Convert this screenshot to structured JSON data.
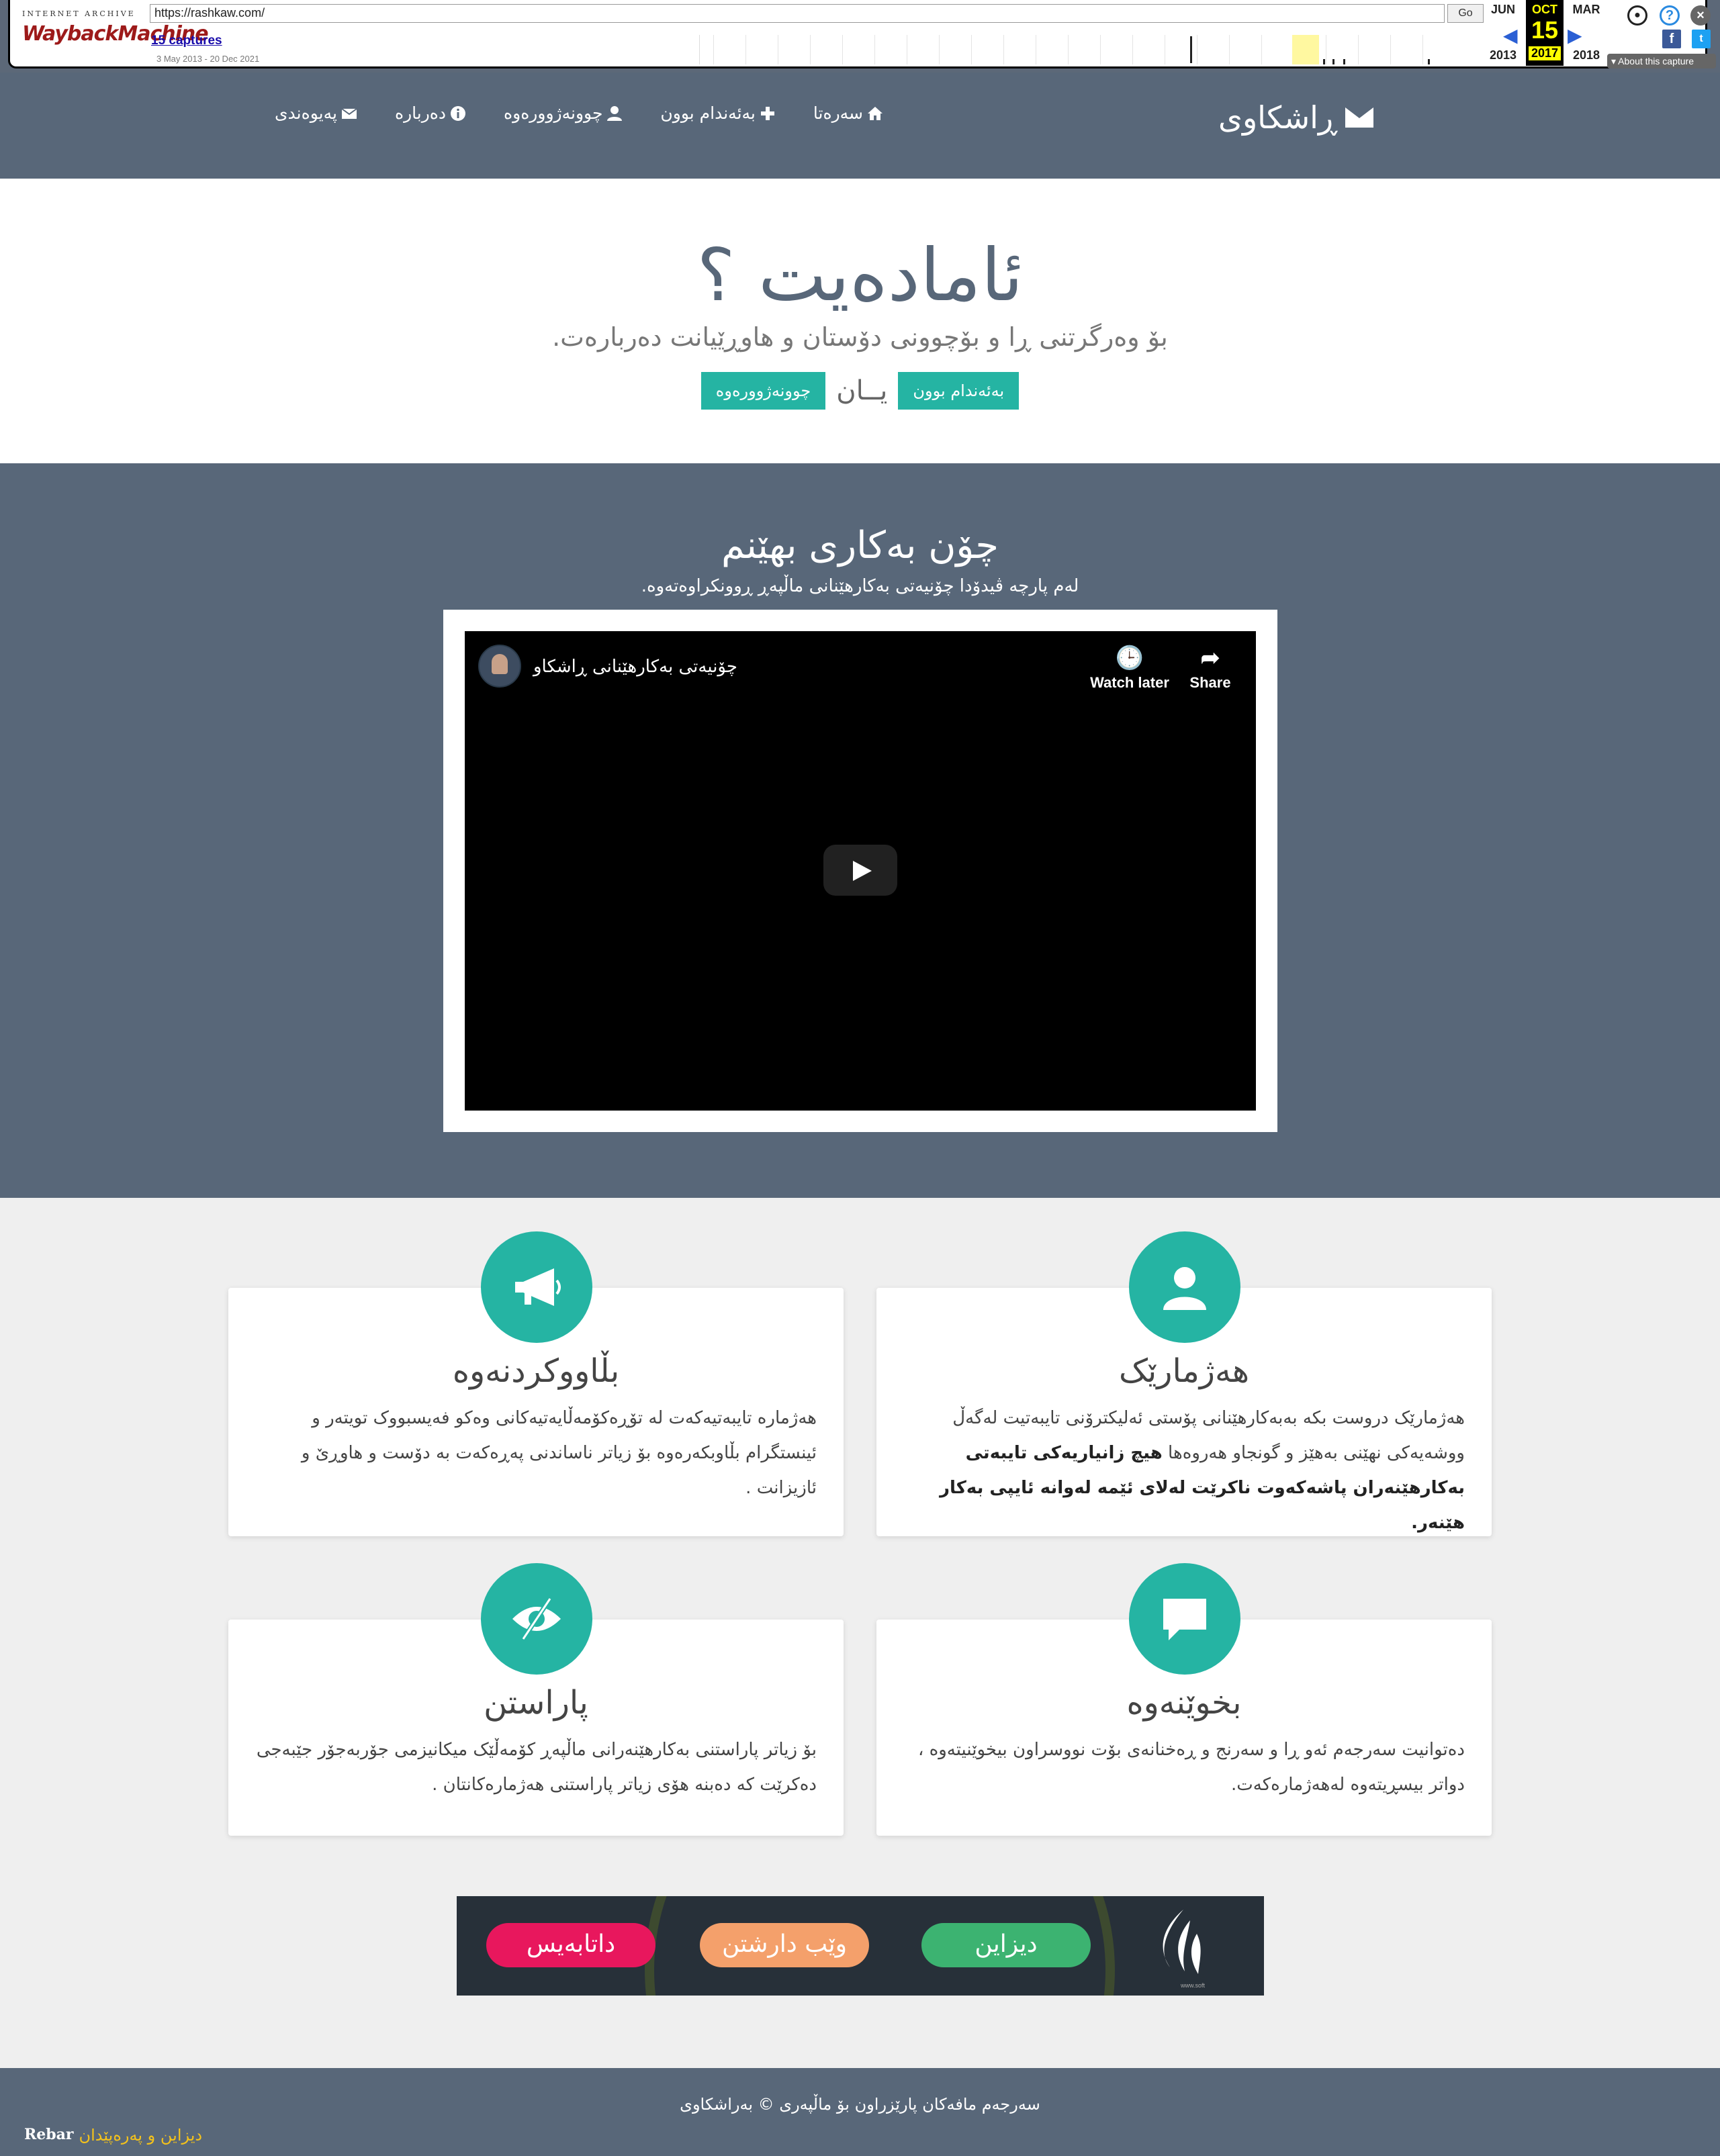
{
  "wayback": {
    "brand_top": "INTERNET ARCHIVE",
    "brand_main": "WaybackMachine",
    "url": "https://rashkaw.com/",
    "go_label": "Go",
    "captures": "15 captures",
    "range": "3 May 2013 - 20 Dec 2021",
    "prev_month": "JUN",
    "cur_month": "OCT",
    "next_month": "MAR",
    "cur_day": "15",
    "prev_year": "2013",
    "cur_year": "2017",
    "next_year": "2018",
    "about": "About this capture"
  },
  "navbar": {
    "brand": "ڕاشکاوی",
    "items": [
      {
        "label": "سەرەتا",
        "icon": "home-icon"
      },
      {
        "label": "بەئەندام بوون",
        "icon": "plus-icon"
      },
      {
        "label": "چوونەژوورەوە",
        "icon": "user-icon"
      },
      {
        "label": "دەربارە",
        "icon": "info-icon"
      },
      {
        "label": "پەیوەندی",
        "icon": "envelope-icon"
      }
    ]
  },
  "hero": {
    "title": "ئامادەیت ؟",
    "lead": "بۆ وەرگرتنی ڕا و بۆچوونی دۆستان و هاوڕێیانت دەربارەت.",
    "register_label": "بەئەندام بوون",
    "or_label": "یــان",
    "login_label": "چوونەژوورەوە"
  },
  "howto": {
    "title": "چۆن بەکاری بهێنم",
    "subtitle": "لەم پارچە ڤیدۆدا چۆنیەتی بەکارهێنانی ماڵپەڕ ڕوونکراوەتەوە.",
    "video_title": "چۆنیەتی بەکارهێنانی ڕاشکاو",
    "watch_later": "Watch later",
    "share": "Share"
  },
  "features": [
    {
      "icon": "user-icon",
      "title": "هەژمارێک",
      "text_plain": "هەژمارێک دروست بکە بەبەکارهێنانی پۆستی ئەلیکترۆنی تایبەتیت لەگەڵ ووشەیەکی نهێنی بەهێز و گونجاو هەروەها ",
      "text_bold": "هیچ زانیاریەکی تایبەتی بەکارهێنەران پاشەکەوت ناکرێت لەلای ئێمە لەوانە ئایپی بەکار هێنەر."
    },
    {
      "icon": "megaphone-icon",
      "title": "بڵاووکردنەوە",
      "text_plain": "هەژمارە تایبەتیەکەت لە تۆڕەکۆمەڵایەتیەکانی وەکو فەیسبووک تویتەر و ئینستگرام بڵاوبکەرەوە بۆ زیاتر ناساندنی پەڕەکەت بە دۆست و هاوڕێ و ئازیزانت .",
      "text_bold": ""
    },
    {
      "icon": "chat-icon",
      "title": "بخوێنەوە",
      "text_plain": "دەتوانیت سەرجەم ئەو ڕا و سەرنج و ڕەخنانەی بۆت نووسراون بیخوێنیتەوە ، دواتر بیسڕیتەوە لەهەژمارەکەت.",
      "text_bold": ""
    },
    {
      "icon": "eye-slash-icon",
      "title": "پاراستن",
      "text_plain": "بۆ زیاتر پاراستنی بەکارهێنەرانی ماڵپەڕ کۆمەڵێک میکانیزمی جۆربەجۆر جێبەجی دەکرێت کە دەبنە هۆی زیاتر پاراستنی هەژمارەکانتان .",
      "text_bold": ""
    }
  ],
  "banner": {
    "pills": [
      {
        "label": "دیزاین",
        "color": "#3cb371"
      },
      {
        "label": "وێب دارشتن",
        "color": "#f4a06b"
      },
      {
        "label": "داتابەیس",
        "color": "#e8175d"
      }
    ],
    "logo_sub": "www.soft"
  },
  "footer": {
    "copyright": "سەرجەم مافەکان پارێزراون بۆ ماڵپەری © بەراشکاوی",
    "credit_link": "دیزاین و پەرەپێدان",
    "credit_brand": "Rebar"
  },
  "colors": {
    "navy": "#586779",
    "teal": "#25b4a3",
    "light_bg": "#efefef",
    "footer_link": "#f4c21b"
  }
}
